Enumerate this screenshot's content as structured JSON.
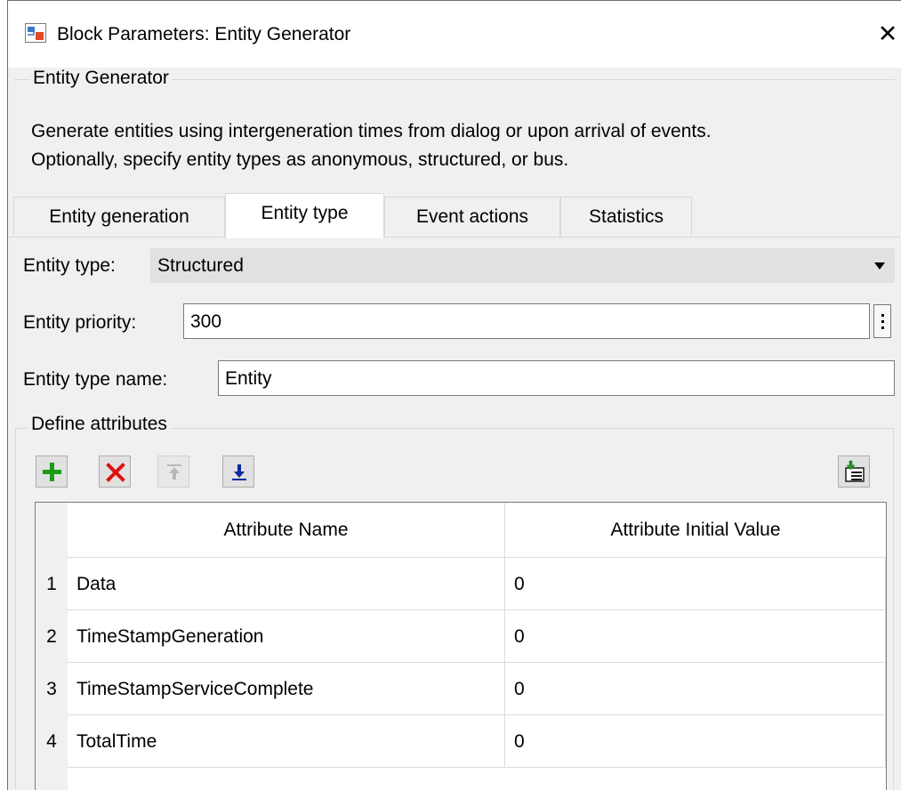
{
  "window": {
    "title": "Block Parameters: Entity Generator",
    "close_glyph": "✕"
  },
  "description": {
    "group_title": "Entity Generator",
    "line1": "Generate entities using intergeneration times from dialog or upon arrival of events.",
    "line2": "Optionally, specify entity types as anonymous, structured, or bus."
  },
  "tabs": [
    {
      "label": "Entity generation",
      "active": false
    },
    {
      "label": "Entity type",
      "active": true
    },
    {
      "label": "Event actions",
      "active": false
    },
    {
      "label": "Statistics",
      "active": false
    }
  ],
  "form": {
    "entity_type_label": "Entity type:",
    "entity_type_value": "Structured",
    "entity_priority_label": "Entity priority:",
    "entity_priority_value": "300",
    "entity_type_name_label": "Entity type name:",
    "entity_type_name_value": "Entity"
  },
  "attributes": {
    "group_title": "Define attributes",
    "toolbar": {
      "add_icon": "plus-icon",
      "delete_icon": "x-icon",
      "move_up_icon": "arrow-up-icon",
      "move_down_icon": "arrow-down-icon",
      "export_icon": "export-icon"
    },
    "columns": [
      "Attribute Name",
      "Attribute Initial Value"
    ],
    "rows": [
      {
        "num": "1",
        "name": "Data",
        "value": "0"
      },
      {
        "num": "2",
        "name": "TimeStampGeneration",
        "value": "0"
      },
      {
        "num": "3",
        "name": "TimeStampServiceComplete",
        "value": "0"
      },
      {
        "num": "4",
        "name": "TotalTime",
        "value": "0"
      }
    ]
  },
  "colors": {
    "add": "#1a9c1a",
    "delete": "#e01010",
    "disabled": "#b8b8b8",
    "move_down": "#0a2a9c",
    "panel_bg": "#f0f0f0"
  }
}
